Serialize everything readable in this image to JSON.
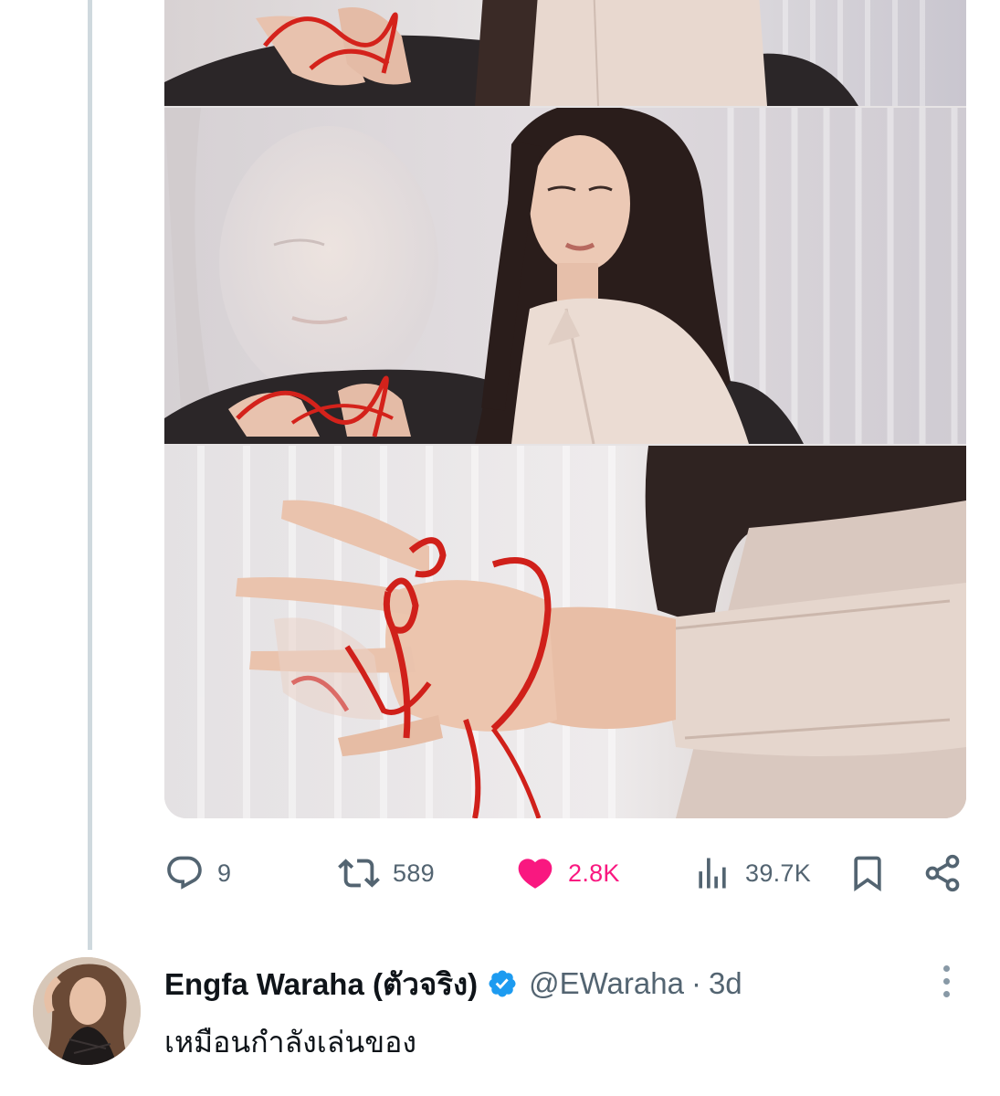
{
  "media": {
    "photos": [
      {
        "label": "photo-top-crop"
      },
      {
        "label": "photo-middle"
      },
      {
        "label": "photo-bottom"
      }
    ]
  },
  "actions": {
    "reply_count": "9",
    "retweet_count": "589",
    "like_count": "2.8K",
    "view_count": "39.7K",
    "like_color": "#f91880",
    "icon_color": "#536471"
  },
  "reply": {
    "display_name": "Engfa Waraha (ตัวจริง)",
    "handle": "@EWaraha",
    "separator": "·",
    "time": "3d",
    "text": "เหมือนกำลังเล่นของ",
    "verified_color": "#1d9bf0"
  }
}
